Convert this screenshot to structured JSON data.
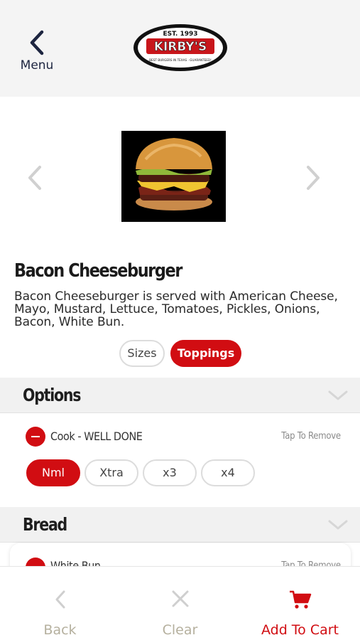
{
  "header": {
    "menu_label": "Menu",
    "logo": {
      "est": "EST. 1993",
      "name": "KIRBY'S",
      "tagline": "BEST BURGERS IN TEXAS · GUARANTEED!"
    }
  },
  "product": {
    "title": "Bacon Cheeseburger",
    "description": "Bacon Cheeseburger is served with American Cheese, Mayo, Mustard, Lettuce, Tomatoes, Pickles, Onions, Bacon, White Bun."
  },
  "tabs": [
    {
      "label": "Sizes",
      "active": false
    },
    {
      "label": "Toppings",
      "active": true
    }
  ],
  "sections": {
    "options": {
      "title": "Options",
      "items": [
        {
          "label": "Cook - WELL DONE",
          "action": "Tap To Remove",
          "quantities": [
            "Nml",
            "Xtra",
            "x3",
            "x4"
          ],
          "selected": "Nml"
        }
      ]
    },
    "bread": {
      "title": "Bread",
      "items": [
        {
          "label": "White Bun",
          "action": "Tap To Remove"
        }
      ]
    }
  },
  "bottom_bar": {
    "back": "Back",
    "clear": "Clear",
    "add_to_cart": "Add To Cart"
  },
  "colors": {
    "accent": "#d10d12",
    "header_bg": "#f4f4f4",
    "muted": "#b5b09e"
  }
}
